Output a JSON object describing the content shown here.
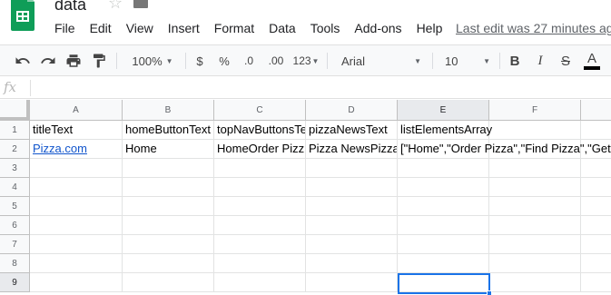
{
  "doc": {
    "title": "data",
    "last_edit": "Last edit was 27 minutes ago"
  },
  "menu": [
    "File",
    "Edit",
    "View",
    "Insert",
    "Format",
    "Data",
    "Tools",
    "Add-ons",
    "Help"
  ],
  "toolbar": {
    "zoom": "100%",
    "currency": "$",
    "percent": "%",
    "decrease_decimals": ".0",
    "increase_decimals": ".00",
    "more_formats": "123",
    "font_family": "Arial",
    "font_size": "10",
    "bold": "B",
    "italic": "I",
    "strikethrough": "S",
    "text_color": "A"
  },
  "formula_bar": {
    "fx_label": "fx",
    "value": ""
  },
  "grid": {
    "columns": [
      "A",
      "B",
      "C",
      "D",
      "E",
      "F"
    ],
    "rows": [
      "1",
      "2",
      "3",
      "4",
      "5",
      "6",
      "7",
      "8",
      "9"
    ],
    "row1": [
      "titleText",
      "homeButtonText",
      "topNavButtonsTe",
      "pizzaNewsText",
      "listElementsArray",
      ""
    ],
    "row2": [
      "Pizza.com",
      "Home",
      "HomeOrder Pizz",
      "Pizza NewsPizza",
      "[\"Home\",\"Order Pizza\",\"Find Pizza\",\"Get",
      ""
    ],
    "selected_cell": "E9"
  },
  "colors": {
    "brand_green": "#0f9d58",
    "selection_blue": "#1a73e8",
    "link_blue": "#1155cc"
  }
}
